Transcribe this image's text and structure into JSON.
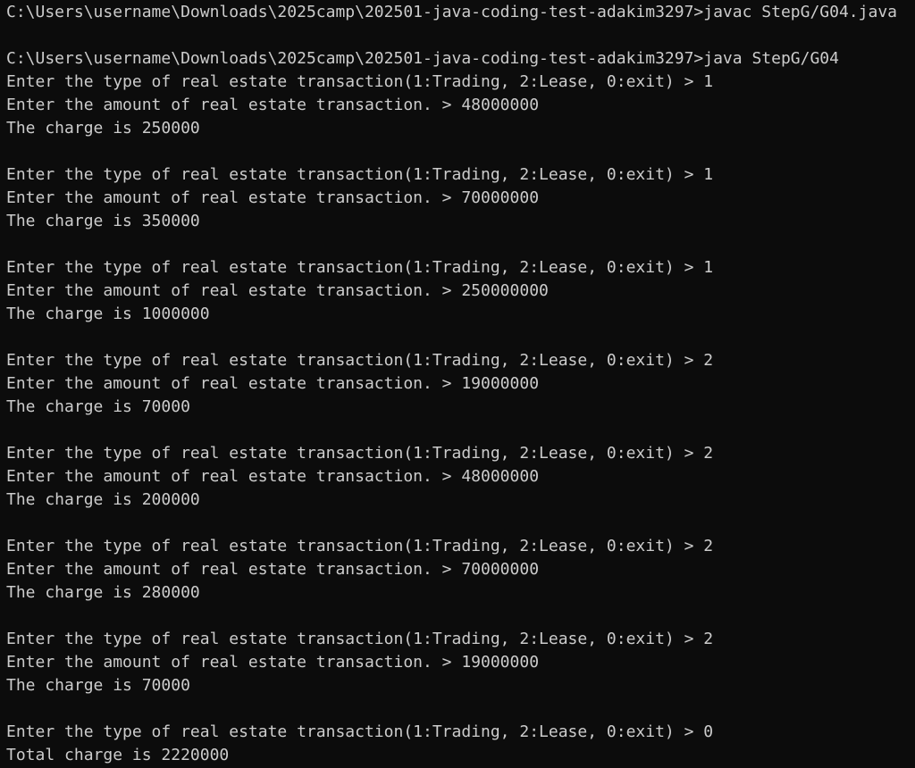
{
  "terminal": {
    "lines": [
      "C:\\Users\\username\\Downloads\\2025camp\\202501-java-coding-test-adakim3297>javac StepG/G04.java",
      "",
      "C:\\Users\\username\\Downloads\\2025camp\\202501-java-coding-test-adakim3297>java StepG/G04",
      "Enter the type of real estate transaction(1:Trading, 2:Lease, 0:exit) > 1",
      "Enter the amount of real estate transaction. > 48000000",
      "The charge is 250000",
      "",
      "Enter the type of real estate transaction(1:Trading, 2:Lease, 0:exit) > 1",
      "Enter the amount of real estate transaction. > 70000000",
      "The charge is 350000",
      "",
      "Enter the type of real estate transaction(1:Trading, 2:Lease, 0:exit) > 1",
      "Enter the amount of real estate transaction. > 250000000",
      "The charge is 1000000",
      "",
      "Enter the type of real estate transaction(1:Trading, 2:Lease, 0:exit) > 2",
      "Enter the amount of real estate transaction. > 19000000",
      "The charge is 70000",
      "",
      "Enter the type of real estate transaction(1:Trading, 2:Lease, 0:exit) > 2",
      "Enter the amount of real estate transaction. > 48000000",
      "The charge is 200000",
      "",
      "Enter the type of real estate transaction(1:Trading, 2:Lease, 0:exit) > 2",
      "Enter the amount of real estate transaction. > 70000000",
      "The charge is 280000",
      "",
      "Enter the type of real estate transaction(1:Trading, 2:Lease, 0:exit) > 2",
      "Enter the amount of real estate transaction. > 19000000",
      "The charge is 70000",
      "",
      "Enter the type of real estate transaction(1:Trading, 2:Lease, 0:exit) > 0",
      "Total charge is 2220000"
    ]
  }
}
